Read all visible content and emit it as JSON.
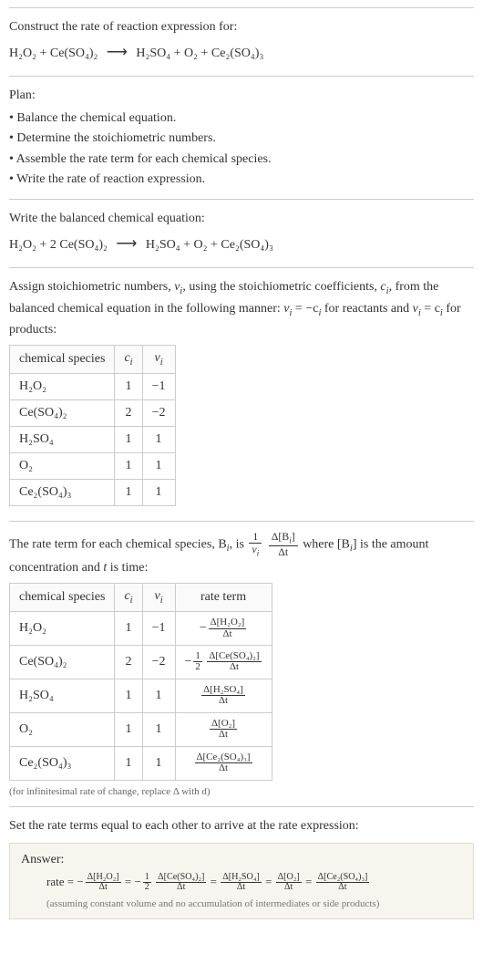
{
  "intro": {
    "line1": "Construct the rate of reaction expression for:",
    "equation_lhs": "H₂O₂ + Ce(SO₄)₂",
    "equation_rhs": "H₂SO₄ + O₂ + Ce₂(SO₄)₃"
  },
  "plan": {
    "heading": "Plan:",
    "items": [
      "• Balance the chemical equation.",
      "• Determine the stoichiometric numbers.",
      "• Assemble the rate term for each chemical species.",
      "• Write the rate of reaction expression."
    ]
  },
  "balanced": {
    "heading": "Write the balanced chemical equation:",
    "lhs": "H₂O₂ + 2 Ce(SO₄)₂",
    "rhs": "H₂SO₄ + O₂ + Ce₂(SO₄)₃"
  },
  "stoich_text": {
    "part1": "Assign stoichiometric numbers, ",
    "nu_i": "ν",
    "sub_i": "i",
    "part2": ", using the stoichiometric coefficients, ",
    "c_i": "c",
    "part3": ", from the balanced chemical equation in the following manner: ",
    "eq1_lhs": "ν",
    "eq1_rhs": " = −c",
    "part4": " for reactants and ",
    "eq2_lhs": "ν",
    "eq2_rhs": " = c",
    "part5": " for products:"
  },
  "table1": {
    "headers": {
      "species": "chemical species",
      "ci": "c",
      "nui": "ν",
      "sub": "i"
    },
    "rows": [
      {
        "species": "H₂O₂",
        "ci": "1",
        "nui": "−1"
      },
      {
        "species": "Ce(SO₄)₂",
        "ci": "2",
        "nui": "−2"
      },
      {
        "species": "H₂SO₄",
        "ci": "1",
        "nui": "1"
      },
      {
        "species": "O₂",
        "ci": "1",
        "nui": "1"
      },
      {
        "species": "Ce₂(SO₄)₃",
        "ci": "1",
        "nui": "1"
      }
    ]
  },
  "rate_term_text": {
    "part1": "The rate term for each chemical species, B",
    "sub_i": "i",
    "part2": ", is ",
    "frac1_num": "1",
    "frac1_den_sym": "ν",
    "frac2_num": "Δ[B",
    "frac2_num_close": "]",
    "frac2_den": "Δt",
    "part3": " where [B",
    "part4": "] is the amount concentration and ",
    "t": "t",
    "part5": " is time:"
  },
  "table2": {
    "headers": {
      "species": "chemical species",
      "ci": "c",
      "nui": "ν",
      "sub": "i",
      "rate": "rate term"
    },
    "rows": [
      {
        "species": "H₂O₂",
        "ci": "1",
        "nui": "−1",
        "neg": "−",
        "coef": "",
        "num": "Δ[H₂O₂]",
        "den": "Δt"
      },
      {
        "species": "Ce(SO₄)₂",
        "ci": "2",
        "nui": "−2",
        "neg": "−",
        "coef_num": "1",
        "coef_den": "2",
        "num": "Δ[Ce(SO₄)₂]",
        "den": "Δt"
      },
      {
        "species": "H₂SO₄",
        "ci": "1",
        "nui": "1",
        "neg": "",
        "coef": "",
        "num": "Δ[H₂SO₄]",
        "den": "Δt"
      },
      {
        "species": "O₂",
        "ci": "1",
        "nui": "1",
        "neg": "",
        "coef": "",
        "num": "Δ[O₂]",
        "den": "Δt"
      },
      {
        "species": "Ce₂(SO₄)₃",
        "ci": "1",
        "nui": "1",
        "neg": "",
        "coef": "",
        "num": "Δ[Ce₂(SO₄)₃]",
        "den": "Δt"
      }
    ],
    "note": "(for infinitesimal rate of change, replace Δ with d)"
  },
  "final_text": "Set the rate terms equal to each other to arrive at the rate expression:",
  "answer": {
    "label": "Answer:",
    "rate_word": "rate = ",
    "terms": [
      {
        "neg": "−",
        "coef_num": "",
        "coef_den": "",
        "num": "Δ[H₂O₂]",
        "den": "Δt"
      },
      {
        "neg": "−",
        "coef_num": "1",
        "coef_den": "2",
        "num": "Δ[Ce(SO₄)₂]",
        "den": "Δt"
      },
      {
        "neg": "",
        "coef_num": "",
        "coef_den": "",
        "num": "Δ[H₂SO₄]",
        "den": "Δt"
      },
      {
        "neg": "",
        "coef_num": "",
        "coef_den": "",
        "num": "Δ[O₂]",
        "den": "Δt"
      },
      {
        "neg": "",
        "coef_num": "",
        "coef_den": "",
        "num": "Δ[Ce₂(SO₄)₃]",
        "den": "Δt"
      }
    ],
    "eq": " = ",
    "note": "(assuming constant volume and no accumulation of intermediates or side products)"
  }
}
